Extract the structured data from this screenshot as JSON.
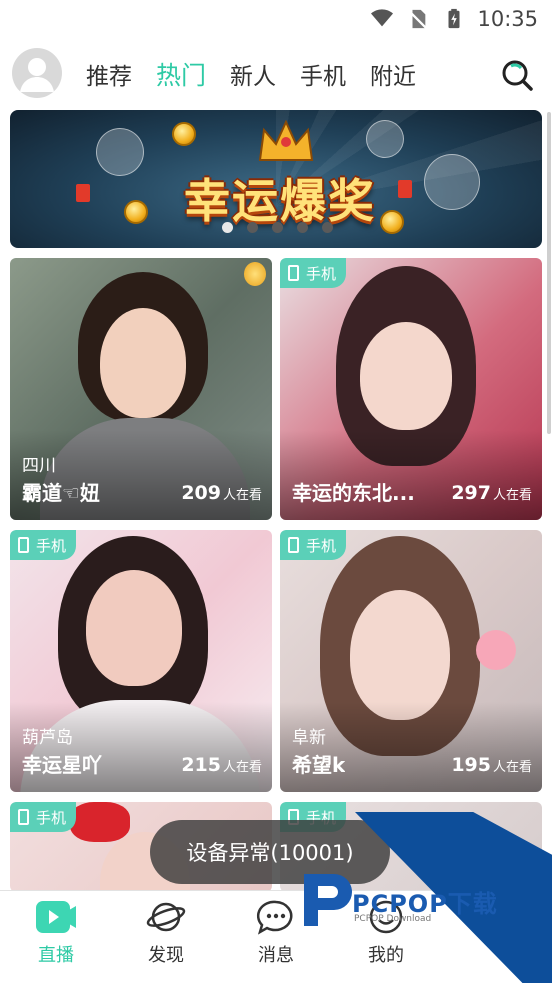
{
  "status": {
    "time": "10:35"
  },
  "tabs": [
    "推荐",
    "热门",
    "新人",
    "手机",
    "附近"
  ],
  "active_tab": 1,
  "banner": {
    "title": "幸运爆奖",
    "slides": 5,
    "active_slide": 0
  },
  "cards": [
    {
      "location": "四川",
      "name": "霸道☜妞",
      "viewers": "209",
      "viewers_unit": "人在看",
      "badge": ""
    },
    {
      "location": "",
      "name": "幸运的东北...",
      "viewers": "297",
      "viewers_unit": "人在看",
      "badge": "手机"
    },
    {
      "location": "葫芦岛",
      "name": "幸运星吖",
      "viewers": "215",
      "viewers_unit": "人在看",
      "badge": "手机"
    },
    {
      "location": "阜新",
      "name": "希望k",
      "viewers": "195",
      "viewers_unit": "人在看",
      "badge": "手机"
    },
    {
      "badge": "手机"
    },
    {
      "badge": "手机"
    }
  ],
  "toast": "设备异常(10001)",
  "bottom_nav": [
    "直播",
    "发现",
    "消息",
    "我的"
  ],
  "active_nav": 0,
  "watermark": {
    "title": "PCPOP下载",
    "subtitle": "PCPOP Download"
  },
  "colors": {
    "accent": "#2ecaa5",
    "badge": "#5bd0b8"
  }
}
